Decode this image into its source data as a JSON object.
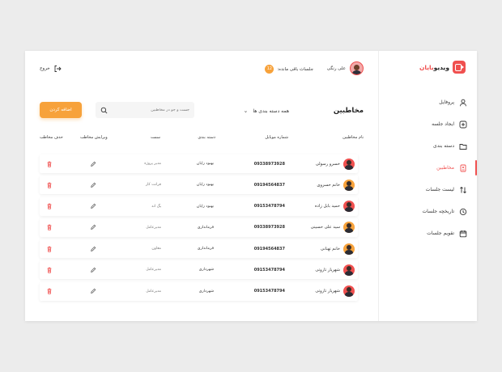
{
  "app": {
    "logo_main": "ویدیو",
    "logo_accent": "بایان"
  },
  "sidebar": {
    "items": [
      {
        "label": "پروفایل",
        "icon": "user-icon"
      },
      {
        "label": "ایجاد جلسه",
        "icon": "plus-square-icon"
      },
      {
        "label": "دسته بندی",
        "icon": "folder-icon"
      },
      {
        "label": "مخاطبین",
        "icon": "contacts-icon",
        "active": true
      },
      {
        "label": "لیست جلسات",
        "icon": "sort-list-icon"
      },
      {
        "label": "تاریخچه جلسات",
        "icon": "history-icon"
      },
      {
        "label": "تقویم جلسات",
        "icon": "calendar-icon"
      }
    ]
  },
  "header": {
    "user_name": "علی رنگی",
    "sessions_label": "جلسات باقی مانده:",
    "sessions_count": "12",
    "logout_label": "خروج"
  },
  "page": {
    "title": "مخاطبین",
    "filter_label": "همه دسته بندی ها",
    "search_placeholder": "جست و جو در مخاطبین",
    "add_button": "اضافه کردن"
  },
  "table": {
    "headers": {
      "name": "نام مخاطبین",
      "phone": "شماره موبایل",
      "category": "دسته بندی",
      "role": "سمت",
      "edit": "ویرایش مخاطب",
      "delete": "حذف مخاطب"
    },
    "rows": [
      {
        "name": "خسرو رسولی",
        "phone": "09338973928",
        "category": "بهبود رایان",
        "role": "مدیر پروژه",
        "avatar_color": "#f0504f"
      },
      {
        "name": "خانم خسروی",
        "phone": "09194564837",
        "category": "بهبود رایان",
        "role": "قرانت کار",
        "avatar_color": "#f7a23b"
      },
      {
        "name": "حمید بابل زاده",
        "phone": "09153478794",
        "category": "بهبود رایان",
        "role": "یگ اند",
        "avatar_color": "#f0504f"
      },
      {
        "name": "سید علی حسینی",
        "phone": "09338973928",
        "category": "فرمانداری",
        "role": "مدیرعامل",
        "avatar_color": "#f7a23b"
      },
      {
        "name": "خانم تهنانی",
        "phone": "09194564837",
        "category": "فرمانداری",
        "role": "معاون",
        "avatar_color": "#f7a23b"
      },
      {
        "name": "شهریار تاروتی",
        "phone": "09153478794",
        "category": "شهرداری",
        "role": "مدیرعامل",
        "avatar_color": "#f0504f"
      },
      {
        "name": "شهریار تاروتی",
        "phone": "09153478794",
        "category": "شهرداری",
        "role": "مدیرعامل",
        "avatar_color": "#f0504f"
      }
    ]
  },
  "colors": {
    "accent": "#f0504f",
    "button": "#f7a23b"
  }
}
